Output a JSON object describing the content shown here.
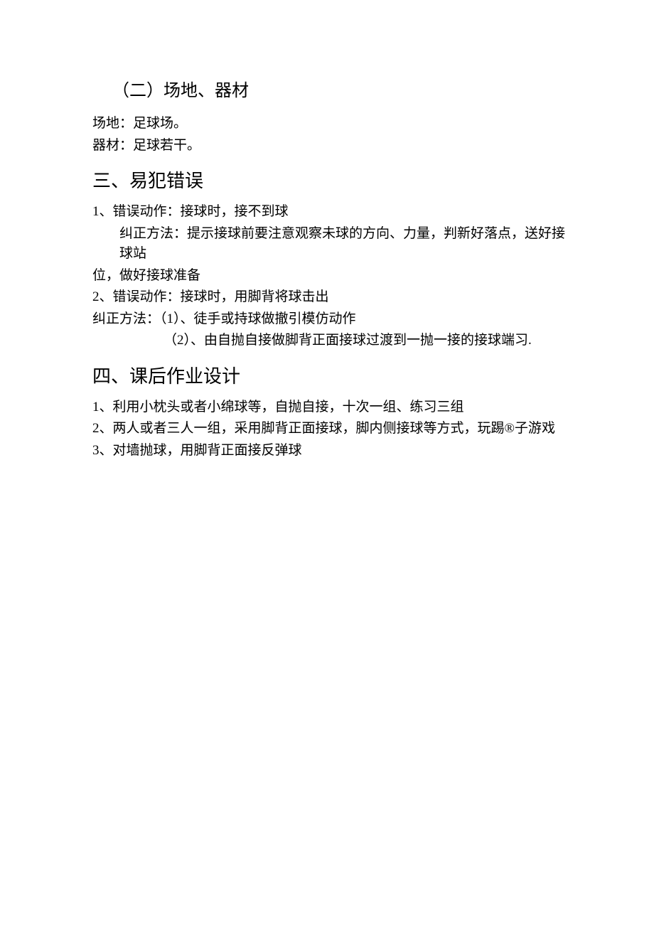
{
  "section2": {
    "heading": "（二）场地、器材",
    "line1": "场地：足球场。",
    "line2": "器材：足球若干。"
  },
  "section3": {
    "heading": "三、易犯错误",
    "item1_err": "1、错误动作：接球时，接不到球",
    "item1_fix": "纠正方法：提示接球前要注意观察未球的方向、力量，判新好落点，送好接球站",
    "item1_fix2": "位，做好接球准备",
    "item2_err": "2、错误动作：接球时，用脚背将球击出",
    "item2_fix1": "纠正方法：（1）、徒手或持球做撤引模仿动作",
    "item2_fix2": "（2）、由自抛自接做脚背正面接球过渡到一抛一接的接球端习."
  },
  "section4": {
    "heading": "四、课后作业设计",
    "item1": "1、利用小枕头或者小绵球等，自抛自接，十次一组、练习三组",
    "item2": "2、两人或者三人一组，采用脚背正面接球，脚内侧接球等方式，玩踢®子游戏",
    "item3": "3、对墙抛球，用脚背正面接反弹球"
  }
}
